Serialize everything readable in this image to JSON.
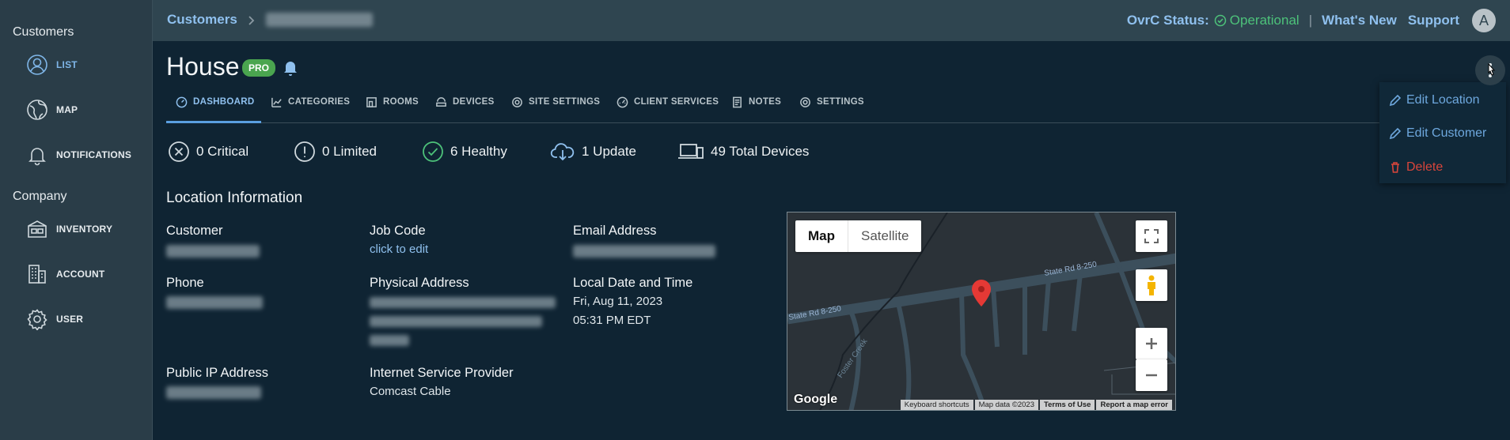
{
  "sidebar": {
    "customers_heading": "Customers",
    "company_heading": "Company",
    "items": [
      {
        "label": "LIST"
      },
      {
        "label": "MAP"
      },
      {
        "label": "NOTIFICATIONS"
      },
      {
        "label": "INVENTORY"
      },
      {
        "label": "ACCOUNT"
      },
      {
        "label": "USER"
      }
    ]
  },
  "topbar": {
    "breadcrumb_root": "Customers",
    "status_label": "OvrC Status:",
    "status_value": "Operational",
    "whats_new": "What's New",
    "support": "Support",
    "avatar_initial": "A"
  },
  "page": {
    "title": "House",
    "badge": "PRO"
  },
  "tabs": [
    {
      "label": "DASHBOARD"
    },
    {
      "label": "CATEGORIES"
    },
    {
      "label": "ROOMS"
    },
    {
      "label": "DEVICES"
    },
    {
      "label": "SITE SETTINGS"
    },
    {
      "label": "CLIENT SERVICES"
    },
    {
      "label": "NOTES"
    },
    {
      "label": "SETTINGS"
    }
  ],
  "stats": {
    "critical": "0 Critical",
    "limited": "0 Limited",
    "healthy": "6 Healthy",
    "update": "1 Update",
    "total": "49 Total Devices"
  },
  "location": {
    "heading": "Location Information",
    "customer_label": "Customer",
    "job_code_label": "Job Code",
    "job_code_value": "click to edit",
    "email_label": "Email Address",
    "phone_label": "Phone",
    "physical_address_label": "Physical Address",
    "local_time_label": "Local Date and Time",
    "local_date": "Fri, Aug 11, 2023",
    "local_time": "05:31 PM EDT",
    "public_ip_label": "Public IP Address",
    "isp_label": "Internet Service Provider",
    "isp_value": "Comcast Cable"
  },
  "map": {
    "map_label": "Map",
    "satellite_label": "Satellite",
    "road1": "State Rd 8-250",
    "road2": "State Rd 8-250",
    "creek": "Foster Creek",
    "brand": "Google",
    "footer": [
      "Keyboard shortcuts",
      "Map data ©2023",
      "Terms of Use",
      "Report a map error"
    ]
  },
  "menu": {
    "edit_location": "Edit Location",
    "edit_customer": "Edit Customer",
    "delete": "Delete"
  },
  "colors": {
    "accent": "#8fc0ee",
    "ok": "#4dc27a",
    "danger": "#d9453b",
    "pin": "#e53935"
  }
}
